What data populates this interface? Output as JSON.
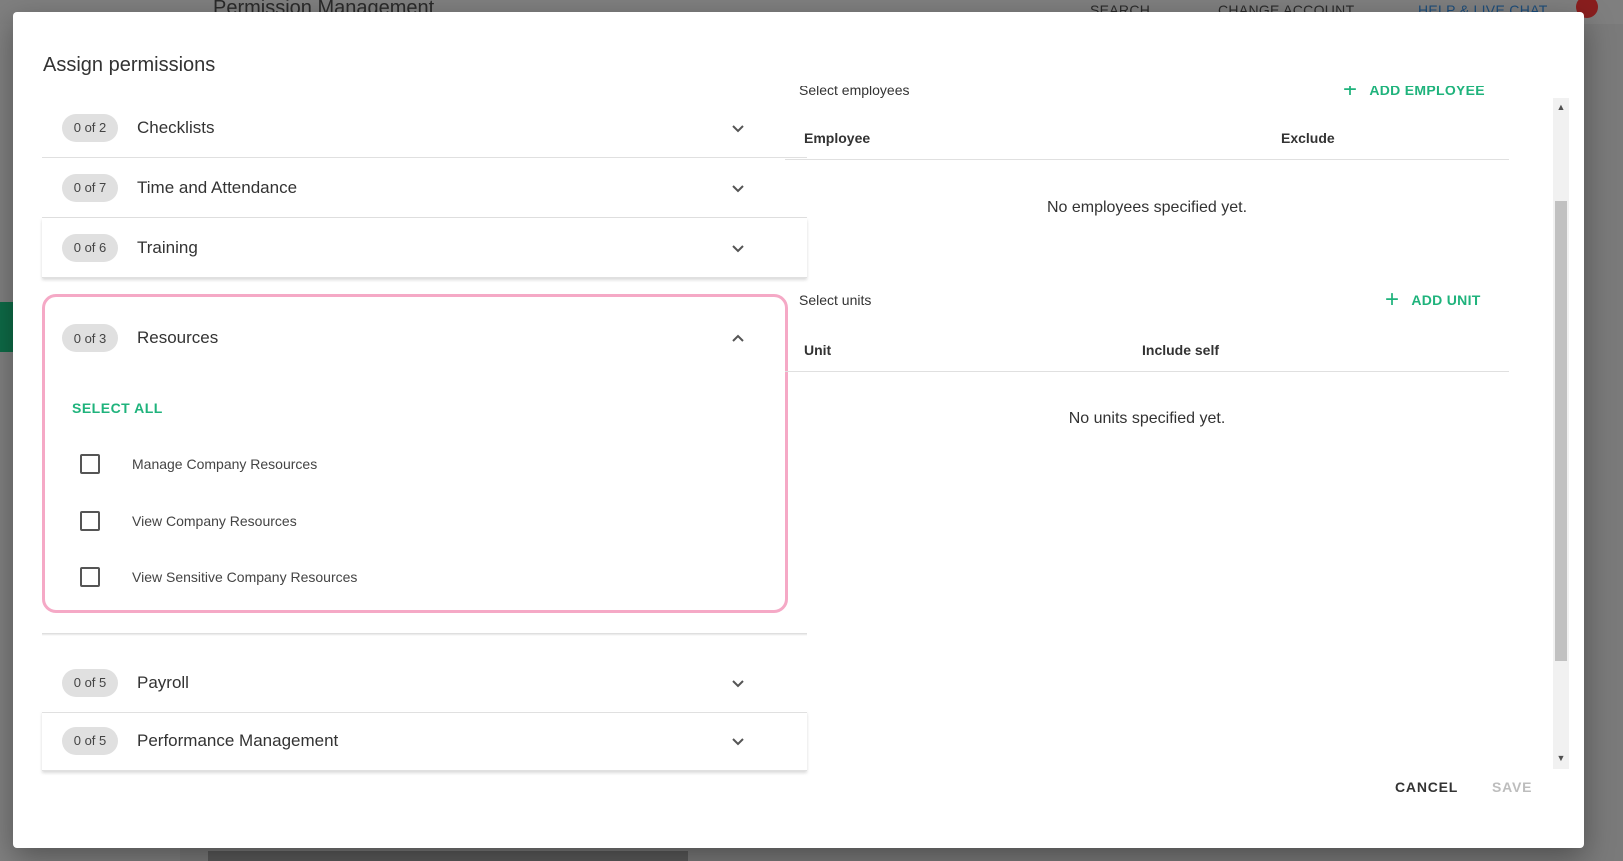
{
  "background": {
    "page_title": "Permission Management",
    "nav": {
      "search": "SEARCH",
      "change_account": "CHANGE ACCOUNT",
      "help": "HELP & LIVE CHAT"
    }
  },
  "dialog": {
    "title": "Assign permissions",
    "groups": [
      {
        "count": "0 of 2",
        "label": "Checklists",
        "expanded": false
      },
      {
        "count": "0 of 7",
        "label": "Time and Attendance",
        "expanded": false
      },
      {
        "count": "0 of 6",
        "label": "Training",
        "expanded": false
      },
      {
        "count": "0 of 3",
        "label": "Resources",
        "expanded": true
      },
      {
        "count": "0 of 5",
        "label": "Payroll",
        "expanded": false
      },
      {
        "count": "0 of 5",
        "label": "Performance Management",
        "expanded": false
      }
    ],
    "resources": {
      "select_all": "SELECT ALL",
      "permissions": [
        {
          "label": "Manage Company Resources",
          "checked": false
        },
        {
          "label": "View Company Resources",
          "checked": false
        },
        {
          "label": "View Sensitive Company Resources",
          "checked": false
        }
      ]
    },
    "employees": {
      "title": "Select employees",
      "add_label": "ADD EMPLOYEE",
      "columns": [
        "Employee",
        "Exclude"
      ],
      "empty": "No employees specified yet."
    },
    "units": {
      "title": "Select units",
      "add_label": "ADD UNIT",
      "columns": [
        "Unit",
        "Include self"
      ],
      "empty": "No units specified yet."
    },
    "footer": {
      "cancel": "CANCEL",
      "save": "SAVE"
    }
  },
  "colors": {
    "accent": "#1fb37c",
    "highlight_border": "#f5a9c6",
    "disabled": "#bdbdbd"
  }
}
